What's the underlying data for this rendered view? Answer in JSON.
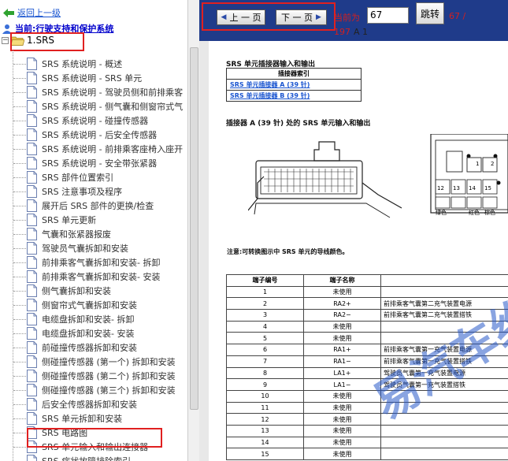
{
  "nav": {
    "back_label": "返回上一级",
    "current_label": "当前:行驶支持和保护系统",
    "root_label": "1.SRS",
    "root_toggle": "−"
  },
  "tree_items": [
    "SRS 系统说明 - 概述",
    "SRS 系统说明 - SRS 单元",
    "SRS 系统说明 - 驾驶员侧和前排乘客",
    "SRS 系统说明 - 侧气囊和侧窗帘式气",
    "SRS 系统说明 - 碰撞传感器",
    "SRS 系统说明 - 后安全传感器",
    "SRS 系统说明 - 前排乘客座椅入座开",
    "SRS 系统说明 - 安全带张紧器",
    "SRS 部件位置索引",
    "SRS 注意事项及程序",
    "展开后 SRS 部件的更换/检查",
    "SRS 单元更新",
    "气囊和张紧器报废",
    "驾驶员气囊拆卸和安装",
    "前排乘客气囊拆卸和安装- 拆卸",
    "前排乘客气囊拆卸和安装- 安装",
    "侧气囊拆卸和安装",
    "侧窗帘式气囊拆卸和安装",
    "电缆盘拆卸和安装- 拆卸",
    "电缆盘拆卸和安装- 安装",
    "前碰撞传感器拆卸和安装",
    "侧碰撞传感器 (第一个) 拆卸和安装",
    "侧碰撞传感器 (第二个) 拆卸和安装",
    "侧碰撞传感器 (第三个) 拆卸和安装",
    "后安全传感器拆卸和安装",
    "SRS 单元拆卸和安装",
    "SRS 电路图",
    "SRS 单元输入和输出连接器",
    "SRS 症状故障排除索引"
  ],
  "toolbar": {
    "prev_label": "上 一 页",
    "next_label": "下 一 页",
    "current_prefix": "当前为",
    "page_value": "67",
    "go_label": "跳转",
    "page_info": "67 /",
    "total": "197",
    "extra": "A 1"
  },
  "doc": {
    "heading": "SRS 单元插接器输入和输出",
    "index_header": "插接器索引",
    "index_links": [
      "SRS 单元插接器 A (39 针)",
      "SRS 单元插接器 B (39 针)"
    ],
    "connector_title": "插接器 A (39 针) 处的 SRS 单元输入和输出",
    "note": "注意:可转换图示中 SRS 单元的导线颜色。",
    "table_headers": [
      "端子编号",
      "端子名称",
      ""
    ],
    "rows": [
      [
        "1",
        "未使用",
        ""
      ],
      [
        "2",
        "RA2+",
        "前排乘客气囊第二充气装置电源"
      ],
      [
        "3",
        "RA2−",
        "前排乘客气囊第二充气装置搭铁"
      ],
      [
        "4",
        "未使用",
        ""
      ],
      [
        "5",
        "未使用",
        ""
      ],
      [
        "6",
        "RA1+",
        "前排乘客气囊第一充气装置电源"
      ],
      [
        "7",
        "RA1−",
        "前排乘客气囊第一充气装置搭铁"
      ],
      [
        "8",
        "LA1+",
        "驾驶员气囊第一充气装置电源"
      ],
      [
        "9",
        "LA1−",
        "驾驶员气囊第一充气装置搭铁"
      ],
      [
        "10",
        "未使用",
        ""
      ],
      [
        "11",
        "未使用",
        ""
      ],
      [
        "12",
        "未使用",
        ""
      ],
      [
        "13",
        "未使用",
        ""
      ],
      [
        "14",
        "未使用",
        ""
      ],
      [
        "15",
        "未使用",
        ""
      ]
    ],
    "pin_labels": {
      "p1": "1",
      "p2": "2",
      "p12": "12",
      "p13": "13",
      "p14": "14",
      "p15": "15",
      "c_green": "绿色",
      "c_red": "红色",
      "c_brown": "棕色"
    },
    "watermark": "易汽车维"
  },
  "colors": {
    "toolbar_bg": "#1f3b8a",
    "highlight": "#e02020",
    "link": "#1a55d0"
  }
}
